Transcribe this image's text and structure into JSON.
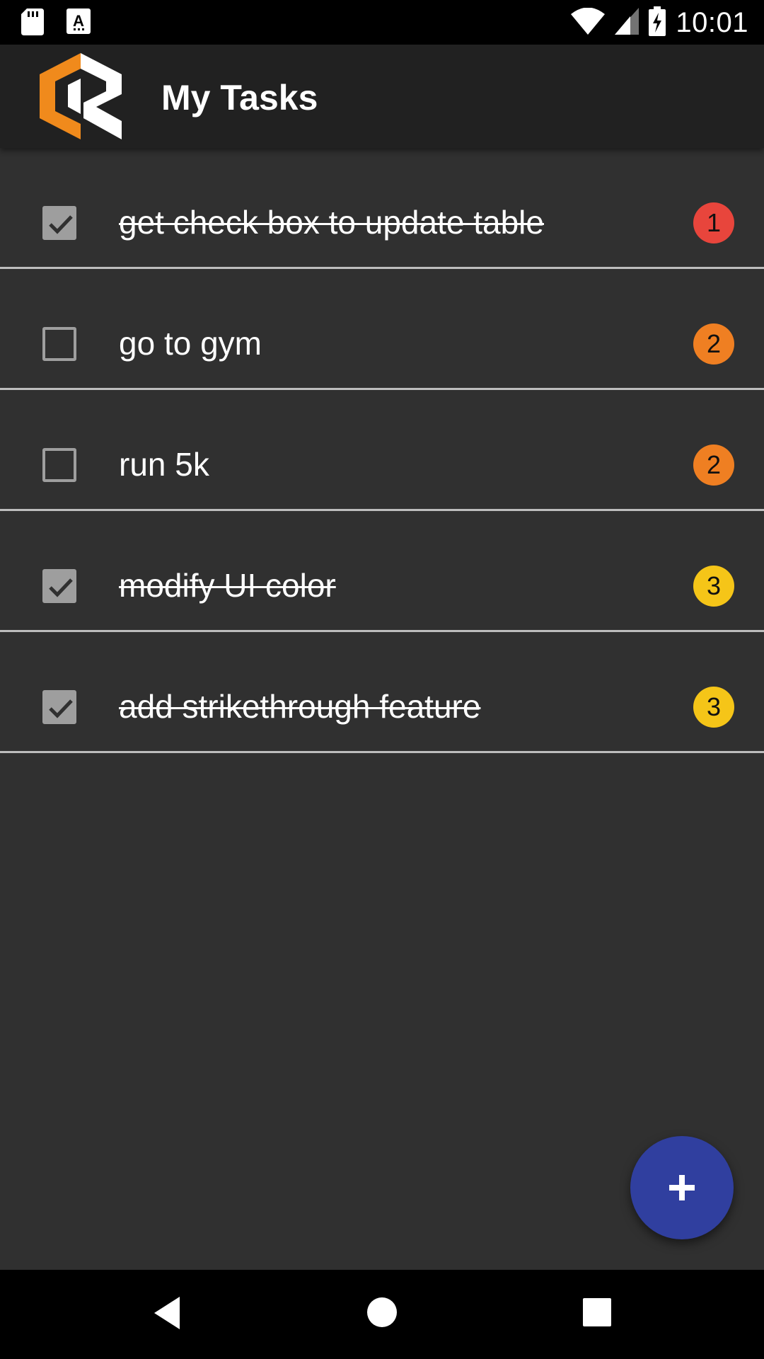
{
  "status_bar": {
    "time": "10:01",
    "left_icons": [
      "sd-card-icon",
      "text-a-icon"
    ],
    "right_icons": [
      "wifi-icon",
      "cell-signal-icon",
      "battery-charging-icon"
    ]
  },
  "app_bar": {
    "title": "My Tasks",
    "logo": "app-logo",
    "colors": {
      "background": "#212121",
      "logo_accent": "#f08a1c"
    }
  },
  "tasks": [
    {
      "text": "get check box to update table",
      "done": true,
      "priority": "1",
      "priority_color": "#e8453c"
    },
    {
      "text": "go to gym",
      "done": false,
      "priority": "2",
      "priority_color": "#ef7f22"
    },
    {
      "text": "run 5k",
      "done": false,
      "priority": "2",
      "priority_color": "#ef7f22"
    },
    {
      "text": "modify UI color",
      "done": true,
      "priority": "3",
      "priority_color": "#f5c518"
    },
    {
      "text": "add strikethrough feature",
      "done": true,
      "priority": "3",
      "priority_color": "#f5c518"
    }
  ],
  "fab": {
    "icon": "plus-icon",
    "color": "#303f9f"
  },
  "nav_bar": {
    "icons": [
      "back-icon",
      "home-icon",
      "recents-icon"
    ]
  },
  "colors": {
    "background": "#303030",
    "divider": "#bdbdbd",
    "checkbox": "#9e9e9e"
  }
}
